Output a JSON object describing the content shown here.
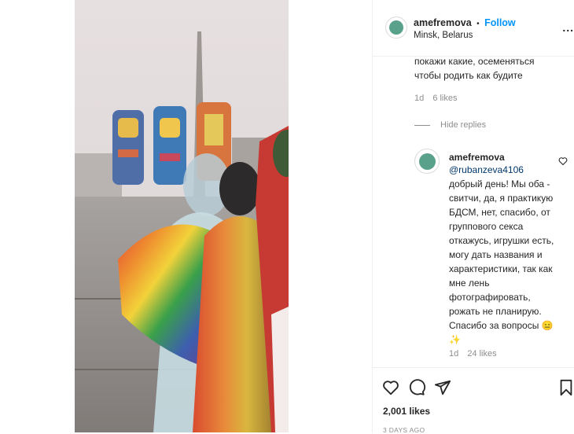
{
  "post": {
    "username": "amefremova",
    "follow_separator": "•",
    "follow_label": "Follow",
    "location": "Minsk, Belarus",
    "more_label": "..."
  },
  "comments": {
    "previous": {
      "text_line1": "покажи какие, осеменяться",
      "text_line2": "чтобы родить как будите",
      "time": "1d",
      "likes": "6 likes"
    },
    "hide_replies_label": "Hide replies",
    "reply": {
      "username": "amefremova",
      "mention": "@rubanzeva4106",
      "lines": [
        "добрый день! Мы оба -",
        "свитчи, да, я практикую",
        "БДСМ, нет, спасибо, от",
        "группового секса",
        "откажусь, игрушки есть,",
        "могу дать названия и",
        "характеристики, так как",
        "мне лень",
        "фотографировать,",
        "рожать не планирую.",
        "Спасибо за вопросы 😑",
        "✨"
      ],
      "time": "1d",
      "likes": "24 likes"
    }
  },
  "actions": {
    "like_icon": "heart-icon",
    "comment_icon": "comment-icon",
    "share_icon": "share-icon",
    "save_icon": "bookmark-icon"
  },
  "likes_count": "2,001 likes",
  "time_ago": "3 DAYS AGO",
  "colors": {
    "accent": "#0095f6",
    "mention": "#00376b",
    "muted": "#8e8e8e",
    "border": "#efefef"
  }
}
